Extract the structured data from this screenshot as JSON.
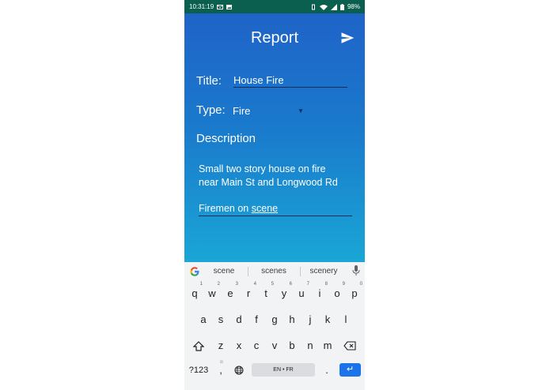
{
  "status_bar": {
    "time": "10:31:19",
    "battery": "98%",
    "icons": [
      "mail-icon",
      "image-icon",
      "vibrate-icon",
      "wifi-icon",
      "signal-icon",
      "battery-icon"
    ]
  },
  "app": {
    "title": "Report",
    "send_icon": "send-icon",
    "title_label": "Title:",
    "title_value": "House Fire",
    "type_label": "Type:",
    "type_value": "Fire",
    "description_label": "Description",
    "description_line1": "Small two story house on fire",
    "description_line2": "near Main St and Longwood Rd",
    "description_line3_prefix": "Firemen on ",
    "description_line3_word": "scene",
    "gradient_colors": [
      "#1f63c8",
      "#1aa6d6"
    ]
  },
  "keyboard": {
    "suggestions": [
      "scene",
      "scenes",
      "scenery"
    ],
    "row1": [
      {
        "k": "q",
        "n": "1"
      },
      {
        "k": "w",
        "n": "2"
      },
      {
        "k": "e",
        "n": "3"
      },
      {
        "k": "r",
        "n": "4"
      },
      {
        "k": "t",
        "n": "5"
      },
      {
        "k": "y",
        "n": "6"
      },
      {
        "k": "u",
        "n": "7"
      },
      {
        "k": "i",
        "n": "8"
      },
      {
        "k": "o",
        "n": "9"
      },
      {
        "k": "p",
        "n": "0"
      }
    ],
    "row2": [
      "a",
      "s",
      "d",
      "f",
      "g",
      "h",
      "j",
      "k",
      "l"
    ],
    "row3": [
      "z",
      "x",
      "c",
      "v",
      "b",
      "n",
      "m"
    ],
    "symbols_label": "?123",
    "comma": ",",
    "period": ".",
    "space_label": "EN • FR",
    "enter_color": "#1a73e8"
  }
}
